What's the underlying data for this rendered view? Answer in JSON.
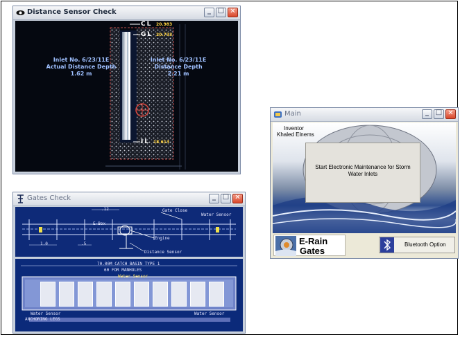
{
  "distance_window": {
    "title": "Distance Sensor Check",
    "marker_cl": "CL",
    "value_cl": "20.983",
    "marker_gl": "GL",
    "value_gl": "20.733",
    "marker_il": "IL",
    "value_il": "18.613",
    "left_label_line1": "Inlet No. 6/23/11E",
    "left_label_line2": "Actual Distance Depth",
    "left_label_line3": "1.62 m",
    "right_label_line1": "Inlet No. 6/23/11E",
    "right_label_line2": "Distance Depth",
    "right_label_line3": "2.21 m"
  },
  "gates_window": {
    "title": "Gates Check",
    "label_gate_close": "Gate Close",
    "label_water_sensor_top": "Water Sensor",
    "label_e_box": "E-Box",
    "label_engine": "Engine",
    "label_distance_sensor": "Distance Sensor",
    "label_basin_1": "70.00M CATCH BASIN TYPE 1",
    "label_basin_2": "60 FOR MANHOLES",
    "label_water_sensor_mid": "Water Sensor",
    "label_water_sensor_left": "Water Sensor",
    "label_water_sensor_right": "Water Sensor",
    "label_anchoring": "ANCHORING LEGS",
    "dim_1": "1.0",
    "dim_2": ".5",
    "dim_3": ".12"
  },
  "main_window": {
    "title": "Main",
    "inventor_label": "Inventor",
    "inventor_name": "Khaled Elnems",
    "start_button": "Start Electronic Maintenance for Storm Water Inlets",
    "brand_line1": "E-Rain",
    "brand_line2": "Gates",
    "bluetooth_button": "Bluetooth Option"
  },
  "window_buttons": {
    "minimize": "_",
    "maximize": "□",
    "close": "✕"
  }
}
